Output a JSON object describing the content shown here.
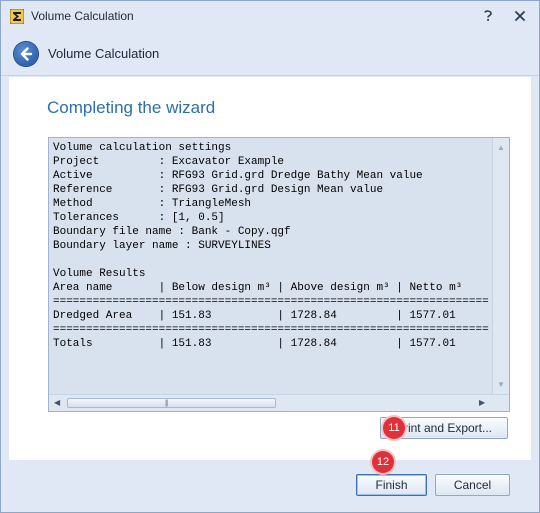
{
  "window": {
    "title": "Volume Calculation"
  },
  "header": {
    "title": "Volume Calculation"
  },
  "page": {
    "title": "Completing the wizard"
  },
  "results_text": "Volume calculation settings\nProject         : Excavator Example\nActive          : RFG93 Grid.grd Dredge Bathy Mean value\nReference       : RFG93 Grid.grd Design Mean value\nMethod          : TriangleMesh\nTolerances      : [1, 0.5]\nBoundary file name : Bank - Copy.qgf\nBoundary layer name : SURVEYLINES\n\nVolume Results\nArea name       | Below design m³ | Above design m³ | Netto m³\n==================================================================\nDredged Area    | 151.83          | 1728.84         | 1577.01\n==================================================================\nTotals          | 151.83          | 1728.84         | 1577.01",
  "buttons": {
    "print_export": "Print and Export...",
    "finish": "Finish",
    "cancel": "Cancel"
  },
  "badges": {
    "export_step": "11",
    "finish_step": "12"
  },
  "colors": {
    "accent": "#2a6fae",
    "badge": "#e0303a",
    "chrome": "#dfe8f4"
  },
  "icons": {
    "app": "sigma-app-icon",
    "help": "help-icon",
    "close": "close-icon",
    "back": "back-arrow-icon"
  }
}
